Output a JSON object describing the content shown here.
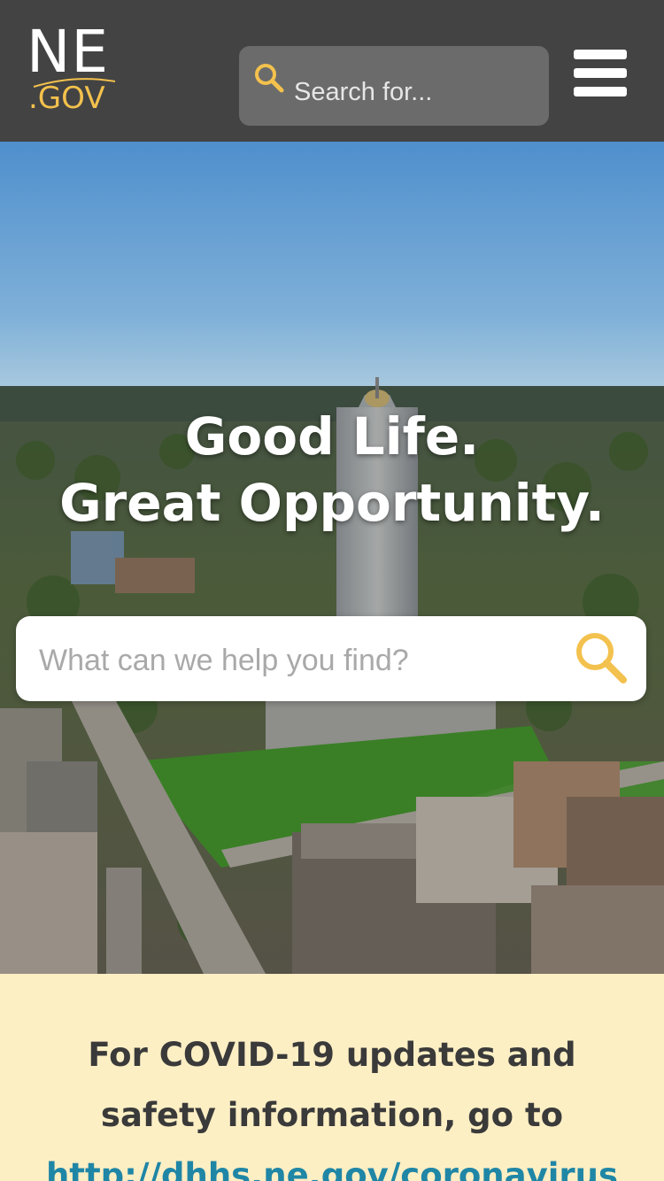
{
  "header": {
    "logo": {
      "main": "NE",
      "sub": ".GOV"
    },
    "search": {
      "placeholder": "Search for...",
      "icon": "search-icon"
    },
    "menu": {
      "icon": "hamburger-menu-icon"
    }
  },
  "hero": {
    "title_line1": "Good Life.",
    "title_line2": "Great Opportunity.",
    "search": {
      "placeholder": "What can we help you find?",
      "icon": "search-icon"
    }
  },
  "notice": {
    "text": "For COVID-19 updates and safety information, go to",
    "link_text": "http://dhhs.ne.gov/coronavirus"
  },
  "colors": {
    "header_bg": "#434343",
    "accent": "#f3c14d",
    "notice_bg": "#fdefc4",
    "link": "#1f86a6"
  }
}
